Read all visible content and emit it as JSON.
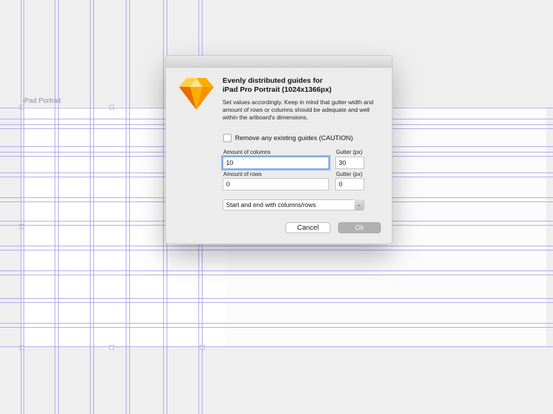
{
  "canvas": {
    "artboard_label": "iPad Portrait"
  },
  "dialog": {
    "title_line1": "Evenly distributed guides for",
    "title_line2": "iPad Pro Portrait (1024x1366px)",
    "description": "Set values accordingly. Keep in mind that gutter width and amount of rows or columns should be adequate and well within the artboard's dimensions.",
    "checkbox": {
      "label": "Remove any existing guides (CAUTION)",
      "checked": false
    },
    "columns": {
      "label": "Amount of columns",
      "value": "10"
    },
    "columns_gutter": {
      "label": "Gutter (px)",
      "value": "30"
    },
    "rows": {
      "label": "Amount of rows",
      "value": "0"
    },
    "rows_gutter": {
      "label": "Gutter (px)",
      "value": "0"
    },
    "select": {
      "selected": "Start and end with columns/rows"
    },
    "buttons": {
      "cancel": "Cancel",
      "ok": "Ok"
    },
    "icon": "sketch-diamond-icon"
  },
  "colors": {
    "guide": "#a9a0e6",
    "focus_ring": "#8fb3e8",
    "sketch_orange": "#f7a31c"
  }
}
